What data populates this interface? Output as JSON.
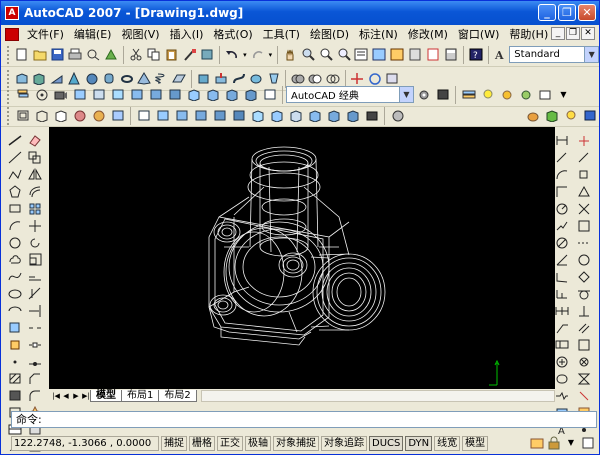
{
  "window": {
    "title": "AutoCAD 2007 - [Drawing1.dwg]",
    "app_icon": "A"
  },
  "menu": [
    "文件(F)",
    "编辑(E)",
    "视图(V)",
    "插入(I)",
    "格式(O)",
    "工具(T)",
    "绘图(D)",
    "标注(N)",
    "修改(M)",
    "窗口(W)",
    "帮助(H)"
  ],
  "toolbars": {
    "text_style": "Standard",
    "workspace": "AutoCAD 经典"
  },
  "tabs": {
    "model": "模型",
    "layout1": "布局1",
    "layout2": "布局2"
  },
  "command": {
    "prompt": "命令:"
  },
  "status": {
    "coords": "122.2748, -1.3066 , 0.0000",
    "buttons": [
      "捕捉",
      "栅格",
      "正交",
      "极轴",
      "对象捕捉",
      "对象追踪",
      "DUCS",
      "DYN",
      "线宽",
      "模型"
    ]
  },
  "colors": {
    "title_bar": "#0a56d6",
    "canvas": "#000000",
    "wireframe": "#ffffff",
    "ucs_icon": "#00c000"
  }
}
